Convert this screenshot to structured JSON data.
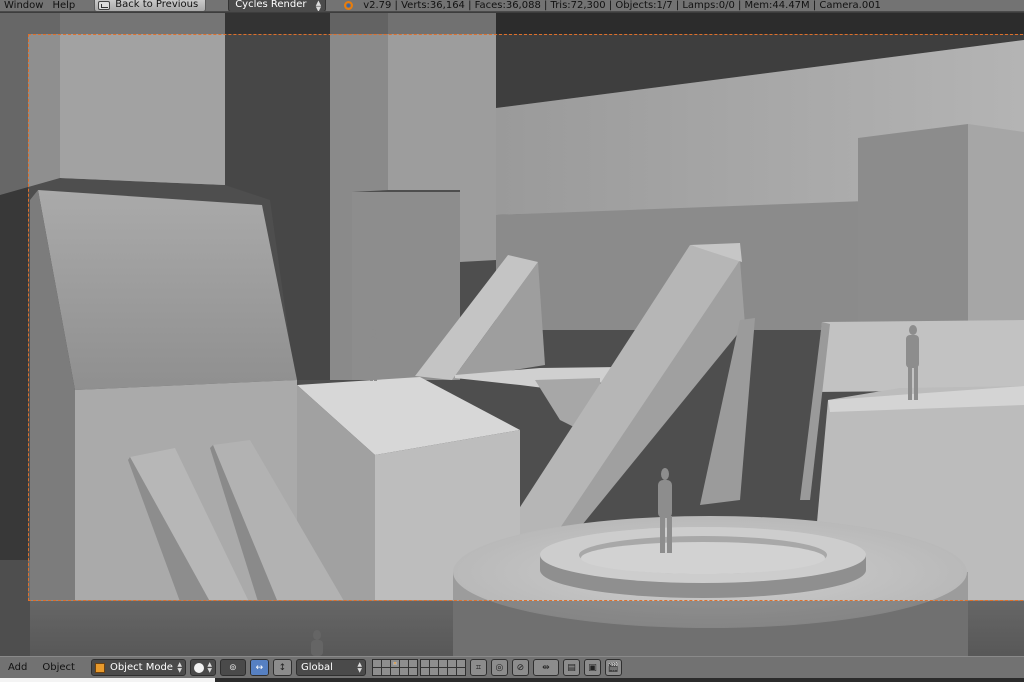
{
  "top_header": {
    "menus": [
      "Window",
      "Help"
    ],
    "back_button_label": "Back to Previous",
    "render_engine": "Cycles Render",
    "stats": "v2.79 | Verts:36,164 | Faces:36,088 | Tris:72,300 | Objects:1/7 | Lamps:0/0 | Mem:44.47M | Camera.001"
  },
  "viewport": {
    "view": "camera",
    "camera_frame_color": "#e0702a"
  },
  "bottom_header": {
    "menus": [
      "Add",
      "Object"
    ],
    "mode": "Object Mode",
    "viewport_shading": "solid",
    "transform_orientation": "Global",
    "icons": [
      "pivot-icon",
      "manipulator-icon",
      "layer-grid",
      "render-still-icon",
      "render-animation-icon"
    ]
  },
  "colors": {
    "header_bg": "#737373",
    "viewport_bg": "#5a5a5a",
    "accent_blue": "#5680c2",
    "blender_orange": "#e87d0d"
  }
}
